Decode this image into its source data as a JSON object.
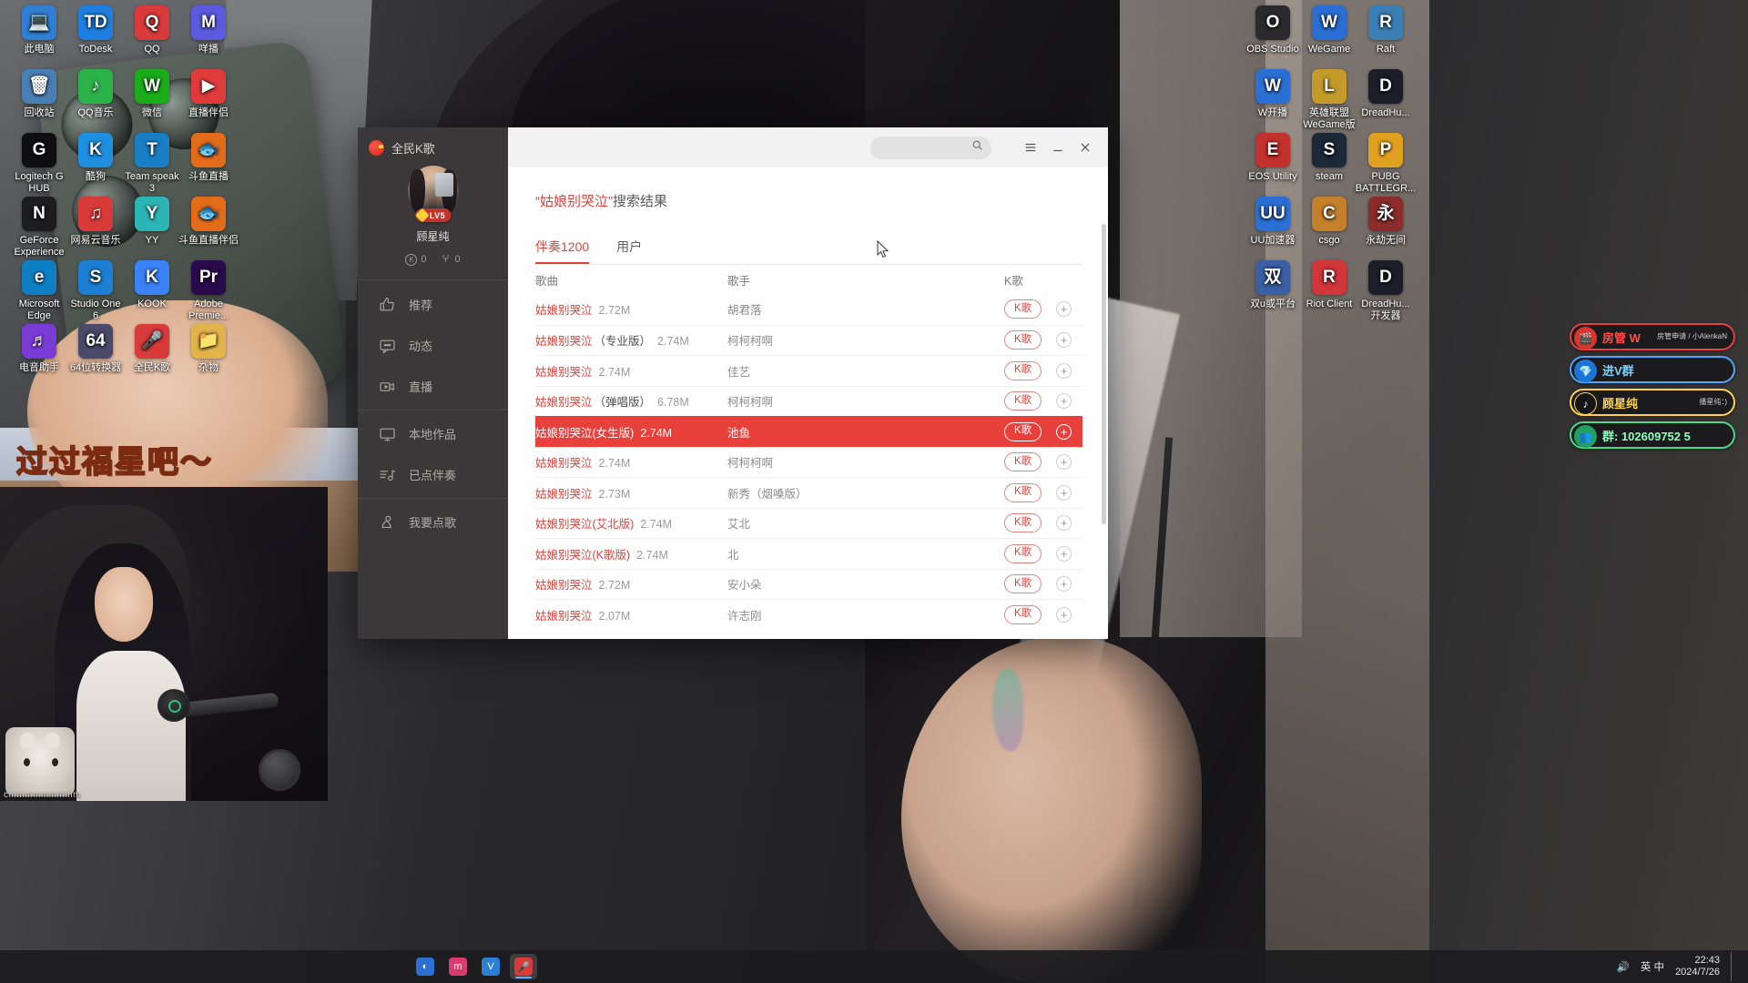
{
  "desktop": {
    "left_icons": [
      {
        "label": "此电脑",
        "glyph": "💻",
        "color": "#2f7fd4"
      },
      {
        "label": "ToDesk",
        "glyph": "TD",
        "color": "#1e7fe0"
      },
      {
        "label": "QQ",
        "glyph": "Q",
        "color": "#d93b3b"
      },
      {
        "label": "咩播",
        "glyph": "M",
        "color": "#5b5be0"
      },
      {
        "label": "回收站",
        "glyph": "🗑",
        "color": "#4a7fb5"
      },
      {
        "label": "QQ音乐",
        "glyph": "♪",
        "color": "#2bb34a"
      },
      {
        "label": "微信",
        "glyph": "W",
        "color": "#1aad19"
      },
      {
        "label": "直播伴侣",
        "glyph": "▶",
        "color": "#e03b3b"
      },
      {
        "label": "Logitech G\nHUB",
        "glyph": "G",
        "color": "#0f0f12"
      },
      {
        "label": "酷狗",
        "glyph": "K",
        "color": "#1f8fe0"
      },
      {
        "label": "Team speak\n3",
        "glyph": "T",
        "color": "#1a7ec4"
      },
      {
        "label": "斗鱼直播",
        "glyph": "🐟",
        "color": "#e36c1a"
      },
      {
        "label": "GeForce\nExperience",
        "glyph": "N",
        "color": "#1d1d1f"
      },
      {
        "label": "网易云音乐",
        "glyph": "♫",
        "color": "#d93b3b"
      },
      {
        "label": "YY",
        "glyph": "Y",
        "color": "#2cb5b5"
      },
      {
        "label": "斗鱼直播伴侣",
        "glyph": "🐟",
        "color": "#e36c1a"
      },
      {
        "label": "Microsoft\nEdge",
        "glyph": "e",
        "color": "#0f7fc4"
      },
      {
        "label": "Studio One\n6",
        "glyph": "S",
        "color": "#1d7fd4"
      },
      {
        "label": "KOOK",
        "glyph": "K",
        "color": "#3b82f6"
      },
      {
        "label": "Adobe\nPremie...",
        "glyph": "Pr",
        "color": "#2a0a4a"
      },
      {
        "label": "电音助手",
        "glyph": "♬",
        "color": "#7a3bd4"
      },
      {
        "label": "64位转换器",
        "glyph": "64",
        "color": "#4a4a6a"
      },
      {
        "label": "全民K歌",
        "glyph": "🎤",
        "color": "#d93b3b"
      },
      {
        "label": "杂物",
        "glyph": "📁",
        "color": "#e0b44a"
      }
    ],
    "right_icons": [
      {
        "label": "OBS Studio",
        "glyph": "O",
        "color": "#2a2a2e"
      },
      {
        "label": "WeGame",
        "glyph": "W",
        "color": "#2b6fd4"
      },
      {
        "label": "Raft",
        "glyph": "R",
        "color": "#3b7fb5"
      },
      {
        "label": "W开播",
        "glyph": "W",
        "color": "#2b6fd4"
      },
      {
        "label": "英雄联盟\nWeGame版",
        "glyph": "L",
        "color": "#c49a2a"
      },
      {
        "label": "DreadHu...",
        "glyph": "D",
        "color": "#1d1d2a"
      },
      {
        "label": "EOS Utility",
        "glyph": "E",
        "color": "#c4302b"
      },
      {
        "label": "steam",
        "glyph": "S",
        "color": "#1b2838"
      },
      {
        "label": "PUBG\nBATTLEGR...",
        "glyph": "P",
        "color": "#e0a020"
      },
      {
        "label": "UU加速器",
        "glyph": "UU",
        "color": "#2b6fd4"
      },
      {
        "label": "csgo",
        "glyph": "C",
        "color": "#c4802b"
      },
      {
        "label": "永劫无间",
        "glyph": "永",
        "color": "#8b2b2b"
      },
      {
        "label": "双u或平台",
        "glyph": "双",
        "color": "#3b5fa5"
      },
      {
        "label": "Riot Client",
        "glyph": "R",
        "color": "#d13639"
      },
      {
        "label": "DreadHu...\n开发器",
        "glyph": "D",
        "color": "#1d1d2a"
      }
    ],
    "wallpaper_caption": "过过福星吧～"
  },
  "overlay_buttons": [
    {
      "label": "房管 W",
      "sub": "房管申请 / 小AlenkaN",
      "icon": "🎬",
      "style": "ob1"
    },
    {
      "label": "进V群",
      "sub": "",
      "icon": "💎",
      "style": "ob2"
    },
    {
      "label": "顾星纯",
      "sub": "播星纯：)",
      "icon": "♪",
      "style": "ob3"
    },
    {
      "label": "102609752 5",
      "sub": "",
      "icon": "👥",
      "style": "ob4",
      "prefix": "群:"
    }
  ],
  "stream_preview": {
    "bottom_text": "cmmmmmmmmm"
  },
  "app": {
    "brand": "全民K歌",
    "profile": {
      "level_badge": "LV5",
      "nickname": "顾星纯",
      "k_count": "0",
      "flower_count": "0"
    },
    "nav_items": [
      {
        "label": "推荐",
        "icon": "thumbs-up-icon"
      },
      {
        "label": "动态",
        "icon": "comment-icon"
      },
      {
        "label": "直播",
        "icon": "video-camera-icon"
      },
      {
        "label": "本地作品",
        "icon": "monitor-icon"
      },
      {
        "label": "已点伴奏",
        "icon": "music-list-icon"
      },
      {
        "label": "我要点歌",
        "icon": "microphone-icon"
      }
    ],
    "titlebar": {
      "search_placeholder": "",
      "search_value": "",
      "menu_label": "☰",
      "minimize_label": "—",
      "close_label": "✕"
    },
    "search_title_query": "“姑娘别哭泣”",
    "search_title_suffix": "搜索结果",
    "tabs": [
      {
        "label": "伴奏1200",
        "active": true
      },
      {
        "label": "用户",
        "active": false
      }
    ],
    "table": {
      "headers": {
        "song": "歌曲",
        "artist": "歌手",
        "k": "K歌"
      },
      "k_button_label": "K歌",
      "add_button_label": "+",
      "rows": [
        {
          "name": "姑娘别哭泣",
          "version": "",
          "size": "2.72M",
          "artist": "胡君落",
          "selected": false
        },
        {
          "name": "姑娘别哭泣",
          "version": "（专业版）",
          "size": "2.74M",
          "artist": "柯柯柯啊",
          "selected": false
        },
        {
          "name": "姑娘别哭泣",
          "version": "",
          "size": "2.74M",
          "artist": "佳艺",
          "selected": false
        },
        {
          "name": "姑娘别哭泣",
          "version": "（弹唱版）",
          "size": "6.78M",
          "artist": "柯柯柯啊",
          "selected": false
        },
        {
          "name": "姑娘别哭泣(女生版)",
          "version": "",
          "size": "2.74M",
          "artist": "池鱼",
          "selected": true
        },
        {
          "name": "姑娘别哭泣",
          "version": "",
          "size": "2.74M",
          "artist": "柯柯柯啊",
          "selected": false
        },
        {
          "name": "姑娘别哭泣",
          "version": "",
          "size": "2.73M",
          "artist": "新秀（烟嗓版）",
          "selected": false
        },
        {
          "name": "姑娘别哭泣(艾北版)",
          "version": "",
          "size": "2.74M",
          "artist": "艾北",
          "selected": false
        },
        {
          "name": "姑娘别哭泣(K歌版)",
          "version": "",
          "size": "2.74M",
          "artist": "北",
          "selected": false
        },
        {
          "name": "姑娘别哭泣",
          "version": "",
          "size": "2.72M",
          "artist": "安小朵",
          "selected": false
        },
        {
          "name": "姑娘别哭泣",
          "version": "",
          "size": "2.07M",
          "artist": "许志刚",
          "selected": false
        }
      ]
    }
  },
  "taskbar": {
    "apps": [
      {
        "name": "cortana",
        "glyph": "◐",
        "color": "#2b6fd4"
      },
      {
        "name": "bilibili",
        "glyph": "m",
        "color": "#d93b6e"
      },
      {
        "name": "browser",
        "glyph": "V",
        "color": "#2b7fd4"
      },
      {
        "name": "wesing",
        "glyph": "🎤",
        "color": "#d93b3b",
        "active": true
      }
    ],
    "clock_time": "22:43",
    "clock_date": "2024/7/26",
    "tray_lang": "英 中",
    "volume_icon": "🔊"
  },
  "colors": {
    "accent_red": "#d8453e",
    "selected_row": "#e8413c",
    "sidebar_bg": "#3b3839"
  }
}
